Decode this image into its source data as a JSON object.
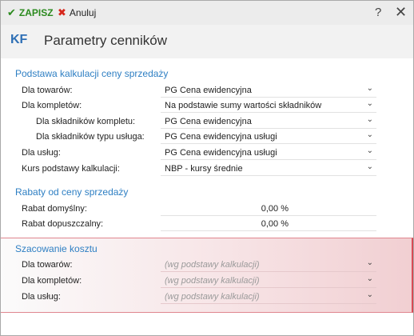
{
  "toolbar": {
    "save_label": "ZAPISZ",
    "cancel_label": "Anuluj",
    "help_label": "?",
    "close_label": "✕"
  },
  "header": {
    "badge": "KF",
    "title": "Parametry cenników"
  },
  "basis": {
    "title": "Podstawa kalkulacji ceny sprzedaży",
    "rows": [
      {
        "label": "Dla towarów:",
        "value": "PG   Cena ewidencyjna"
      },
      {
        "label": "Dla kompletów:",
        "value": "Na podstawie sumy wartości składników"
      },
      {
        "label": "Dla składników kompletu:",
        "value": "PG   Cena ewidencyjna"
      },
      {
        "label": "Dla składników typu usługa:",
        "value": "PG   Cena ewidencyjna usługi"
      },
      {
        "label": "Dla usług:",
        "value": "PG   Cena ewidencyjna usługi"
      },
      {
        "label": "Kurs podstawy kalkulacji:",
        "value": "NBP - kursy średnie"
      }
    ]
  },
  "discounts": {
    "title": "Rabaty od ceny sprzedaży",
    "rows": [
      {
        "label": "Rabat domyślny:",
        "value": "0,00 %"
      },
      {
        "label": "Rabat dopuszczalny:",
        "value": "0,00 %"
      }
    ]
  },
  "cost": {
    "title": "Szacowanie kosztu",
    "rows": [
      {
        "label": "Dla towarów:",
        "value": "(wg podstawy kalkulacji)"
      },
      {
        "label": "Dla kompletów:",
        "value": "(wg podstawy kalkulacji)"
      },
      {
        "label": "Dla usług:",
        "value": "(wg podstawy kalkulacji)"
      }
    ]
  },
  "icons": {
    "save": "check-icon",
    "cancel": "x-icon",
    "dropdown": "chevron-down-icon"
  },
  "colors": {
    "accent": "#2e7fc3",
    "save": "#2b8a1e",
    "cancel": "#d6261b",
    "highlight_border": "#d94a55"
  }
}
